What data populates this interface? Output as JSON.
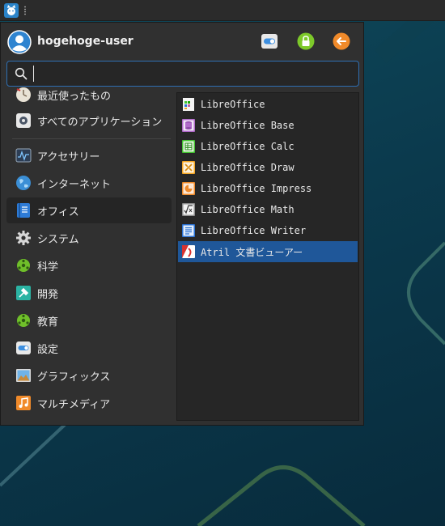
{
  "panel": {
    "menu_button_icon": "whisker-menu-icon"
  },
  "header": {
    "username": "hogehoge-user",
    "buttons": [
      {
        "icon": "settings-toggle-icon"
      },
      {
        "icon": "lock-icon"
      },
      {
        "icon": "logout-icon"
      }
    ]
  },
  "search": {
    "value": "",
    "placeholder": ""
  },
  "categories": [
    {
      "label": "最近使ったもの",
      "icon": "recent-icon"
    },
    {
      "label": "すべてのアプリケーション",
      "icon": "all-apps-icon"
    },
    {
      "label": "アクセサリー",
      "icon": "accessories-icon"
    },
    {
      "label": "インターネット",
      "icon": "internet-icon"
    },
    {
      "label": "オフィス",
      "icon": "office-icon",
      "active": true
    },
    {
      "label": "システム",
      "icon": "system-gear-icon"
    },
    {
      "label": "科学",
      "icon": "science-icon"
    },
    {
      "label": "開発",
      "icon": "development-icon"
    },
    {
      "label": "教育",
      "icon": "education-icon"
    },
    {
      "label": "設定",
      "icon": "settings-icon"
    },
    {
      "label": "グラフィックス",
      "icon": "graphics-icon"
    },
    {
      "label": "マルチメディア",
      "icon": "multimedia-icon"
    }
  ],
  "apps": [
    {
      "label": "LibreOffice",
      "icon": "libreoffice-icon"
    },
    {
      "label": "LibreOffice Base",
      "icon": "libreoffice-base-icon"
    },
    {
      "label": "LibreOffice Calc",
      "icon": "libreoffice-calc-icon"
    },
    {
      "label": "LibreOffice Draw",
      "icon": "libreoffice-draw-icon"
    },
    {
      "label": "LibreOffice Impress",
      "icon": "libreoffice-impress-icon"
    },
    {
      "label": "LibreOffice Math",
      "icon": "libreoffice-math-icon"
    },
    {
      "label": "LibreOffice Writer",
      "icon": "libreoffice-writer-icon"
    },
    {
      "label": "Atril 文書ビューアー",
      "icon": "atril-document-viewer-icon",
      "selected": true
    }
  ],
  "colors": {
    "selection": "#1f5799",
    "search_border": "#2f6fb3",
    "accent_green": "#8bd11f",
    "accent_orange": "#f08a2a"
  }
}
